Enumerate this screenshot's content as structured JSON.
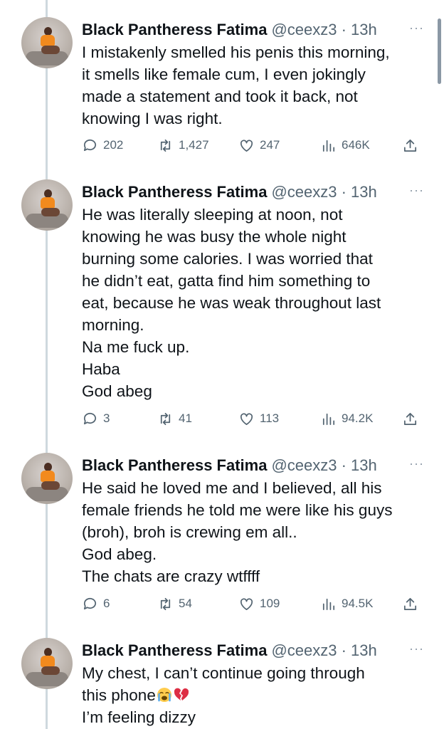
{
  "tweets": [
    {
      "name": "Black Pantheress Fatima",
      "handle": "@ceexz3 · 13h",
      "more": "···",
      "lines": [
        "I mistakenly smelled his penis this morning,",
        "it smells like female cum, I even jokingly",
        "made a statement and took it back, not",
        "knowing I was right."
      ],
      "replies": "202",
      "retweets": "1,427",
      "likes": "247",
      "views": "646K"
    },
    {
      "name": "Black Pantheress Fatima",
      "handle": "@ceexz3 · 13h",
      "more": "···",
      "lines": [
        "He was literally sleeping at noon, not",
        "knowing he was busy the whole night",
        "burning some calories. I was worried that",
        "he didn’t eat, gatta find him something to",
        "eat, because he was weak throughout last",
        "morning.",
        "Na me fuck up.",
        "Haba",
        "God abeg"
      ],
      "replies": "3",
      "retweets": "41",
      "likes": "113",
      "views": "94.2K"
    },
    {
      "name": "Black Pantheress Fatima",
      "handle": "@ceexz3 · 13h",
      "more": "···",
      "lines": [
        "He said he loved me and I believed, all his",
        "female friends he told me were like his guys",
        "(broh), broh is crewing em all..",
        "God abeg.",
        "The chats are crazy wtffff"
      ],
      "replies": "6",
      "retweets": "54",
      "likes": "109",
      "views": "94.5K"
    },
    {
      "name": "Black Pantheress Fatima",
      "handle": "@ceexz3 · 13h",
      "more": "···",
      "lines": [
        "My chest, I can’t continue going through",
        "this phone",
        "I’m feeling dizzy"
      ],
      "emojis": [
        "loudly-crying-face",
        "broken-heart"
      ]
    }
  ],
  "icons": {
    "reply": "reply-icon",
    "retweet": "retweet-icon",
    "like": "heart-icon",
    "views": "views-icon",
    "share": "share-icon"
  },
  "colors": {
    "text": "#0f1419",
    "muted": "#536471",
    "thread_line": "#cfd9de"
  }
}
